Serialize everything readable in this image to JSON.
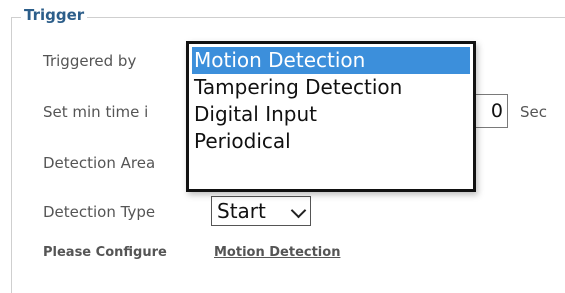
{
  "trigger": {
    "legend": "Trigger",
    "triggered_by_label": "Triggered by",
    "min_time_label": "Set min time i",
    "min_time_value": "0",
    "min_time_unit": "Sec",
    "detection_area_label": "Detection Area",
    "detection_type_label": "Detection Type",
    "detection_type_value": "Start",
    "please_configure_label": "Please Configure",
    "configure_link": "Motion Detection"
  },
  "dropdown": {
    "options": [
      {
        "label": "Motion Detection",
        "selected": true
      },
      {
        "label": "Tampering Detection",
        "selected": false
      },
      {
        "label": "Digital Input",
        "selected": false
      },
      {
        "label": "Periodical",
        "selected": false
      }
    ]
  },
  "colors": {
    "selected_bg": "#3c8fdb",
    "legend": "#2c5e8a"
  }
}
